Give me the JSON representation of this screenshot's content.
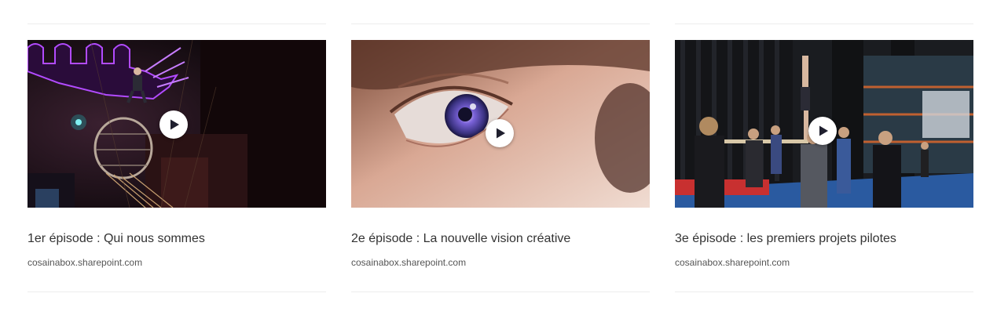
{
  "cards": [
    {
      "title": "1er épisode : Qui nous sommes",
      "source": "cosainabox.sharepoint.com",
      "thumbnail": "circus-performer-stage-thumbnail",
      "play_icon": "play-icon"
    },
    {
      "title": "2e épisode : La nouvelle vision créative",
      "source": "cosainabox.sharepoint.com",
      "thumbnail": "close-up-eye-thumbnail",
      "play_icon": "play-icon"
    },
    {
      "title": "3e épisode : les premiers projets pilotes",
      "source": "cosainabox.sharepoint.com",
      "thumbnail": "acrobats-rehearsal-thumbnail",
      "play_icon": "play-icon"
    }
  ],
  "colors": {
    "divider": "#ededed",
    "title_text": "#333333",
    "source_text": "#555555",
    "play_button_bg": "#ffffff",
    "play_glyph": "#1f1f2e"
  }
}
